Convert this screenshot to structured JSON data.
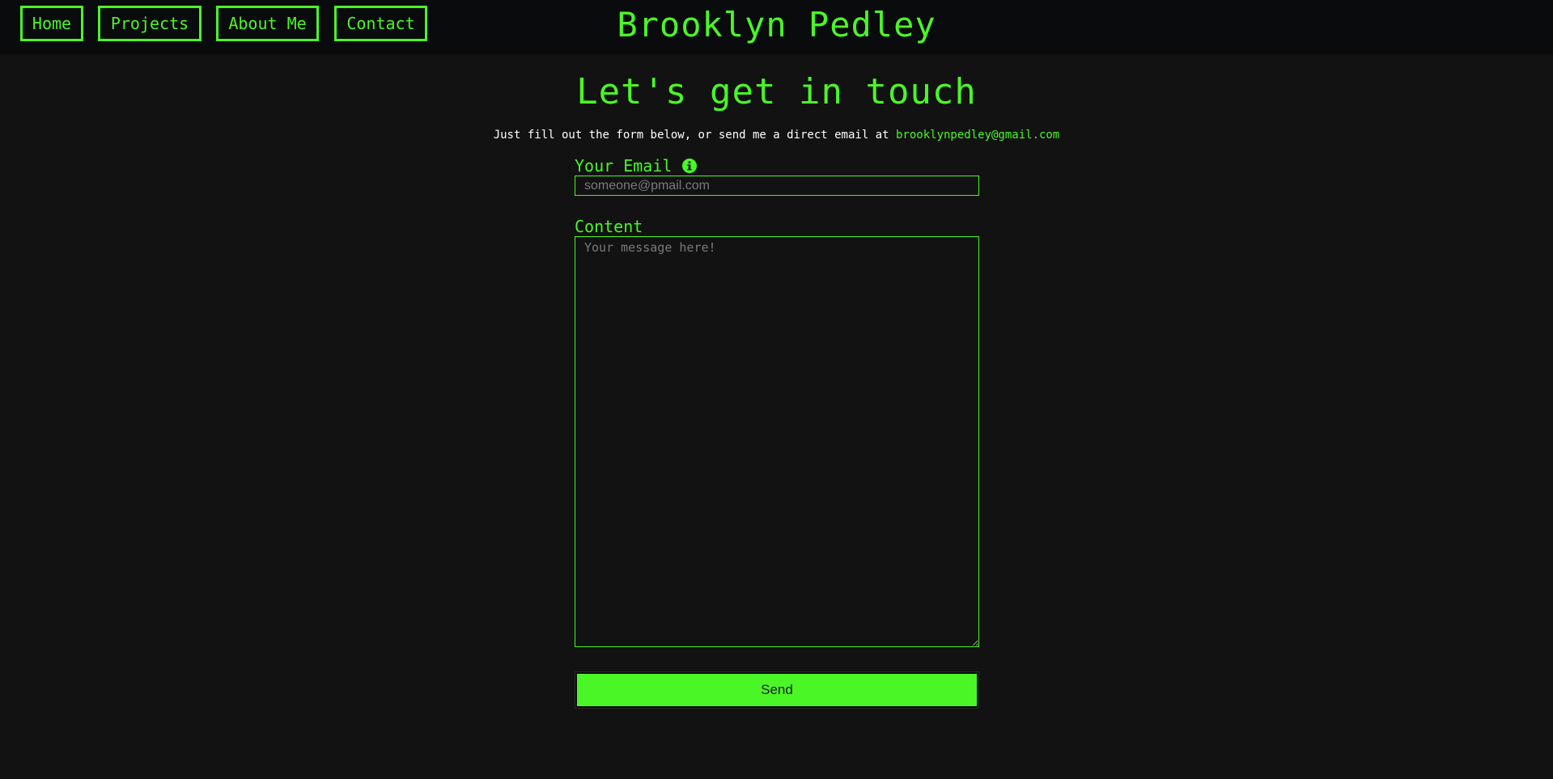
{
  "nav": {
    "items": [
      {
        "label": "Home"
      },
      {
        "label": "Projects"
      },
      {
        "label": "About Me"
      },
      {
        "label": "Contact"
      }
    ],
    "site_title": "Brooklyn Pedley"
  },
  "main": {
    "heading": "Let's get in touch",
    "subtitle_text": "Just fill out the form below, or send me a direct email at",
    "subtitle_email": "brooklynpedley@gmail.com",
    "email_label": "Your Email",
    "email_placeholder": "someone@pmail.com",
    "content_label": "Content",
    "content_placeholder": "Your message here!",
    "send_label": "Send"
  },
  "icons": {
    "email_info": "info-icon"
  },
  "colors": {
    "accent": "#4af626",
    "background": "#121212",
    "navbar_background": "#0a0b0d",
    "text": "#ffffff"
  }
}
